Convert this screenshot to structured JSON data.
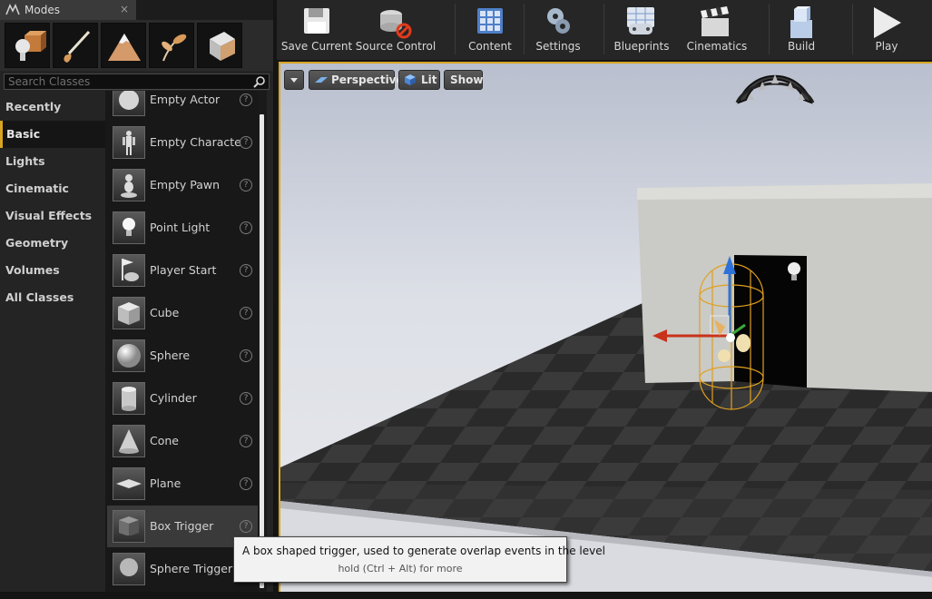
{
  "modes_panel": {
    "tab_title": "Modes",
    "close_glyph": "×",
    "mode_icons": [
      "place-mode-icon",
      "paint-mode-icon",
      "landscape-mode-icon",
      "foliage-mode-icon",
      "geometry-mode-icon"
    ],
    "search": {
      "placeholder": "Search Classes",
      "value": ""
    },
    "categories": [
      {
        "label": "Recently Placed",
        "active": false
      },
      {
        "label": "Basic",
        "active": true
      },
      {
        "label": "Lights",
        "active": false
      },
      {
        "label": "Cinematic",
        "active": false
      },
      {
        "label": "Visual Effects",
        "active": false
      },
      {
        "label": "Geometry",
        "active": false
      },
      {
        "label": "Volumes",
        "active": false
      },
      {
        "label": "All Classes",
        "active": false
      }
    ],
    "items": [
      {
        "label": "Empty Actor",
        "icon": "empty-actor-icon"
      },
      {
        "label": "Empty Characte",
        "icon": "empty-character-icon"
      },
      {
        "label": "Empty Pawn",
        "icon": "empty-pawn-icon"
      },
      {
        "label": "Point Light",
        "icon": "point-light-icon"
      },
      {
        "label": "Player Start",
        "icon": "player-start-icon"
      },
      {
        "label": "Cube",
        "icon": "cube-icon"
      },
      {
        "label": "Sphere",
        "icon": "sphere-icon"
      },
      {
        "label": "Cylinder",
        "icon": "cylinder-icon"
      },
      {
        "label": "Cone",
        "icon": "cone-icon"
      },
      {
        "label": "Plane",
        "icon": "plane-icon"
      },
      {
        "label": "Box Trigger",
        "icon": "box-trigger-icon"
      },
      {
        "label": "Sphere Trigger",
        "icon": "sphere-trigger-icon"
      }
    ],
    "help_glyph": "?"
  },
  "toolbar": {
    "save_current": "Save Current",
    "source_control": "Source Control",
    "content": "Content",
    "settings": "Settings",
    "blueprints": "Blueprints",
    "cinematics": "Cinematics",
    "build": "Build",
    "play": "Play"
  },
  "viewport": {
    "perspective_label": "Perspective",
    "lit_label": "Lit",
    "show_label": "Show"
  },
  "tooltip": {
    "line1": "A box shaped trigger, used to generate overlap events in the level",
    "line2": "hold (Ctrl + Alt) for more"
  },
  "colors": {
    "accent": "#d9a520",
    "panel_bg": "#242424",
    "sky_top": "#cfd3de",
    "floor_dark": "#2c2c2c"
  }
}
